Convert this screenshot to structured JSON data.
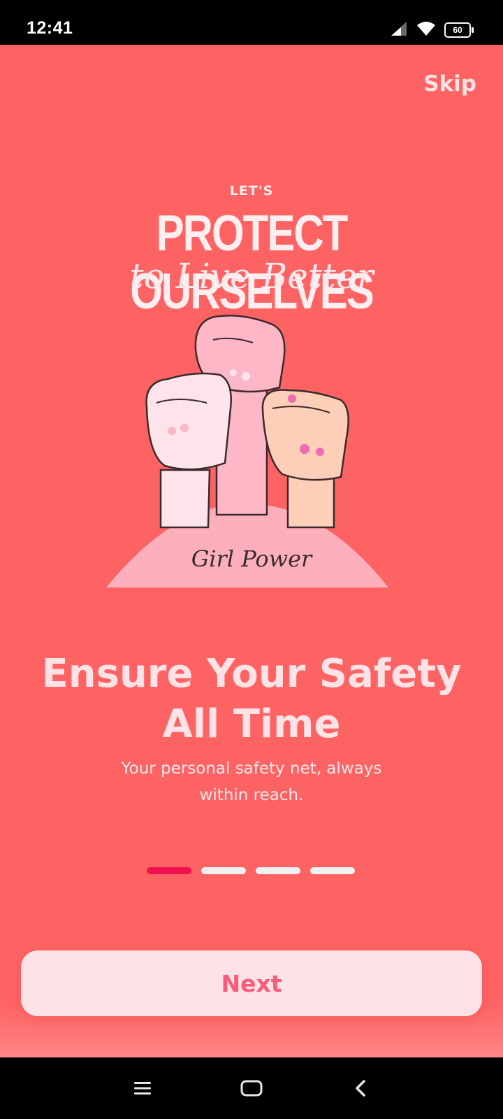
{
  "status_bar": {
    "time": "12:41",
    "battery_level": "60",
    "icons": [
      "signal-icon",
      "wifi-icon",
      "battery-icon"
    ]
  },
  "onboarding": {
    "skip_label": "Skip",
    "illustration": {
      "kicker": "LET'S",
      "headline": "PROTECT OURSELVES",
      "script": "to Live Better",
      "badge": "Girl Power"
    },
    "title_line1": "Ensure Your Safety",
    "title_line2": "All Time",
    "subtitle_line1": "Your personal safety net, always",
    "subtitle_line2": "within reach.",
    "pager": {
      "total": 4,
      "active_index": 0
    },
    "next_label": "Next"
  },
  "colors": {
    "background": "#fe6363",
    "accent": "#f0104f",
    "button_bg": "#fde3e6",
    "button_text": "#fb5a78",
    "text_light": "#fde3e6"
  },
  "nav_bar": {
    "icons": [
      "menu-icon",
      "home-icon",
      "back-icon"
    ]
  }
}
